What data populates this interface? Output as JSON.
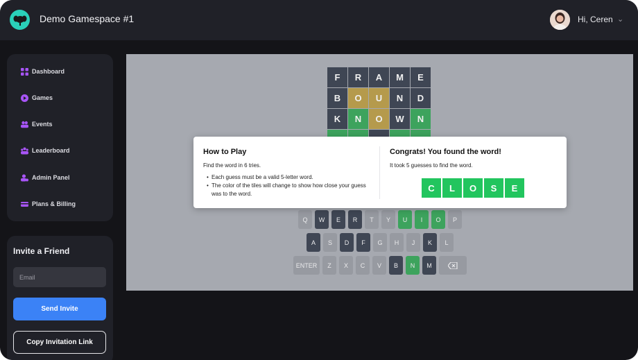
{
  "header": {
    "workspace_title": "Demo Gamespace #1",
    "greeting": "Hi, Ceren"
  },
  "sidebar": {
    "items": [
      {
        "label": "Dashboard",
        "icon": "dashboard-icon"
      },
      {
        "label": "Games",
        "icon": "play-icon"
      },
      {
        "label": "Events",
        "icon": "people-icon"
      },
      {
        "label": "Leaderboard",
        "icon": "team-icon"
      },
      {
        "label": "Admin Panel",
        "icon": "admin-icon"
      },
      {
        "label": "Plans & Billing",
        "icon": "billing-icon"
      }
    ]
  },
  "invite": {
    "title": "Invite a Friend",
    "email_placeholder": "Email",
    "send_label": "Send Invite",
    "copy_label": "Copy Invitation Link"
  },
  "board": {
    "rows": [
      {
        "letters": [
          "F",
          "R",
          "A",
          "M",
          "E"
        ],
        "states": [
          "absent",
          "absent",
          "absent",
          "absent",
          "absent"
        ]
      },
      {
        "letters": [
          "B",
          "O",
          "U",
          "N",
          "D"
        ],
        "states": [
          "absent",
          "present",
          "present",
          "absent",
          "absent"
        ]
      },
      {
        "letters": [
          "K",
          "N",
          "O",
          "W",
          "N"
        ],
        "states": [
          "absent",
          "correct",
          "present",
          "absent",
          "correct"
        ]
      }
    ]
  },
  "keyboard": {
    "rows": [
      [
        {
          "k": "Q",
          "s": "unused"
        },
        {
          "k": "W",
          "s": "absent"
        },
        {
          "k": "E",
          "s": "absent"
        },
        {
          "k": "R",
          "s": "absent"
        },
        {
          "k": "T",
          "s": "unused"
        },
        {
          "k": "Y",
          "s": "unused"
        },
        {
          "k": "U",
          "s": "correct"
        },
        {
          "k": "I",
          "s": "correct"
        },
        {
          "k": "O",
          "s": "correct"
        },
        {
          "k": "P",
          "s": "unused"
        }
      ],
      [
        {
          "k": "A",
          "s": "absent"
        },
        {
          "k": "S",
          "s": "unused"
        },
        {
          "k": "D",
          "s": "absent"
        },
        {
          "k": "F",
          "s": "absent"
        },
        {
          "k": "G",
          "s": "unused"
        },
        {
          "k": "H",
          "s": "unused"
        },
        {
          "k": "J",
          "s": "unused"
        },
        {
          "k": "K",
          "s": "absent"
        },
        {
          "k": "L",
          "s": "unused"
        }
      ],
      [
        {
          "k": "ENTER",
          "s": "unused"
        },
        {
          "k": "Z",
          "s": "unused"
        },
        {
          "k": "X",
          "s": "unused"
        },
        {
          "k": "C",
          "s": "unused"
        },
        {
          "k": "V",
          "s": "unused"
        },
        {
          "k": "B",
          "s": "absent"
        },
        {
          "k": "N",
          "s": "correct"
        },
        {
          "k": "M",
          "s": "absent"
        },
        {
          "k": "⌫",
          "s": "unused"
        }
      ]
    ]
  },
  "modal": {
    "how_title": "How to Play",
    "how_intro": "Find the word in 6 tries.",
    "rules": [
      "Each guess must be a valid 5-letter word.",
      "The color of the tiles will change to show how close your guess was to the word."
    ],
    "congrats_title": "Congrats! You found the word!",
    "congrats_text": "It took 5 guesses to find the word.",
    "answer_letters": [
      "C",
      "L",
      "O",
      "S",
      "E"
    ]
  },
  "colors": {
    "absent": "#3f4654",
    "present": "#b59a4c",
    "correct": "#3da35d",
    "unused_key": "#979aa1",
    "accent_blue": "#3b82f6",
    "sidebar_icon": "#a855f7"
  }
}
